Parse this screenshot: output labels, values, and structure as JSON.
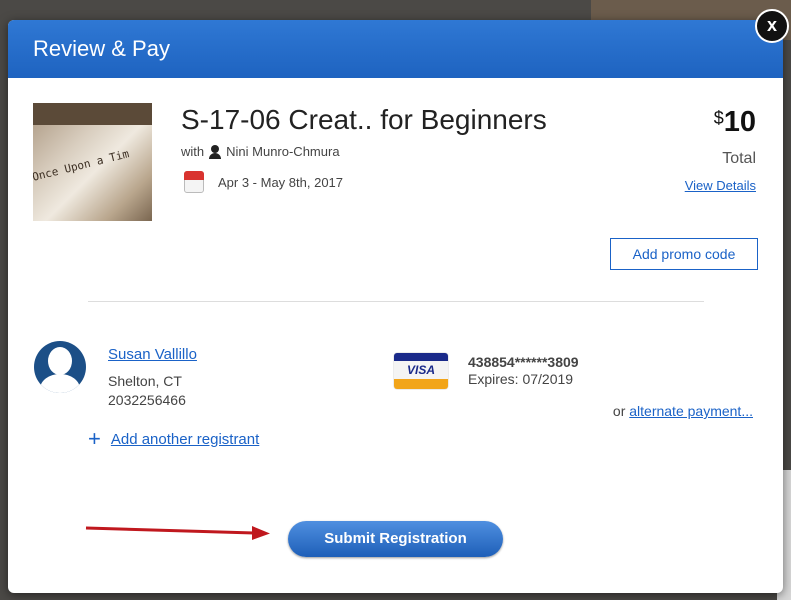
{
  "modal": {
    "title": "Review & Pay",
    "close_label": "x"
  },
  "course": {
    "title": "S-17-06 Creat.. for Beginners",
    "with_label": "with",
    "instructor": "Nini Munro-Chmura",
    "dates": "Apr 3 - May 8th, 2017",
    "thumb_text": "Once Upon a Tim"
  },
  "price": {
    "currency": "$",
    "amount": "10",
    "total_label": "Total",
    "view_details": "View Details"
  },
  "promo": {
    "button_label": "Add promo code"
  },
  "registrant": {
    "name": "Susan Vallillo",
    "location": "Shelton, CT",
    "phone": "2032256466",
    "add_label": "Add another registrant",
    "plus": "+"
  },
  "payment": {
    "card_brand": "VISA",
    "card_number": "438854******3809",
    "expires": "Expires: 07/2019",
    "alt_prefix": "or",
    "alt_label": "alternate payment..."
  },
  "submit": {
    "label": "Submit Registration"
  },
  "colors": {
    "header": "#2f78d4",
    "link": "#1a62c7",
    "annotation_arrow": "#c0181e"
  }
}
